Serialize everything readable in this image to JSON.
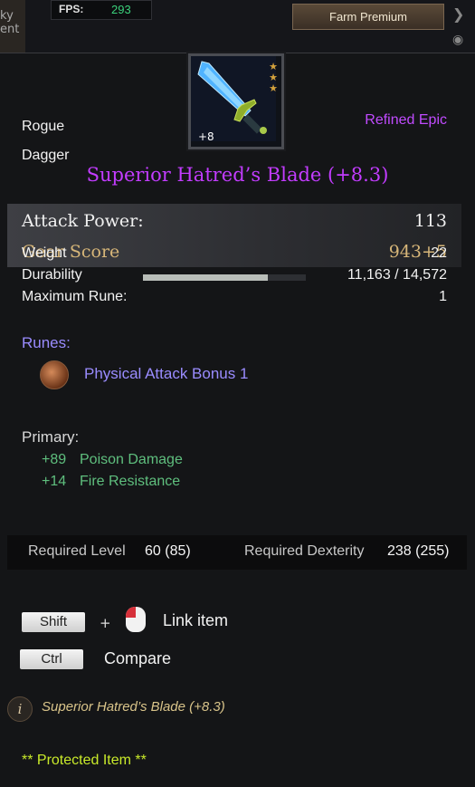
{
  "hud": {
    "tab_label": "ky ent",
    "fps_label": "FPS:",
    "fps_value": "293",
    "farm_button": "Farm Premium"
  },
  "item": {
    "enhance_level": "+8",
    "class": "Rogue",
    "type": "Dagger",
    "rarity": "Refined Epic",
    "name": "Superior Hatred’s Blade (+8.3)",
    "attack_power_label": "Attack Power:",
    "attack_power_value": "113",
    "gear_score_label": "Gear Score",
    "gear_score_value": "943+5",
    "weight_label": "Weight",
    "weight_value": "22",
    "durability_label": "Durability",
    "durability_value": "11,163 / 14,572",
    "durability_fraction": 0.766,
    "max_rune_label": "Maximum Rune:",
    "max_rune_value": "1",
    "runes_label": "Runes:",
    "rune_name": "Physical Attack Bonus 1",
    "primary_label": "Primary:",
    "primary": [
      {
        "value": "+89",
        "name": "Poison Damage"
      },
      {
        "value": "+14",
        "name": "Fire Resistance"
      }
    ],
    "req_level_label": "Required Level",
    "req_level_value": "60 (85)",
    "req_dex_label": "Required Dexterity",
    "req_dex_value": "238 (255)",
    "lore": "Superior Hatred’s Blade (+8.3)",
    "protected": "** Protected Item **"
  },
  "controls": {
    "shift_key": "Shift",
    "plus": "+",
    "link_label": "Link item",
    "ctrl_key": "Ctrl",
    "compare_label": "Compare"
  },
  "colors": {
    "rarity": "#c14bff",
    "stat_green": "#5fbf7e",
    "rune_purple": "#9a8cff",
    "gear_gold": "#d7b679",
    "protected": "#c9ea2a"
  },
  "icons": {
    "weapon": "dagger-icon",
    "rune": "rune-icon",
    "mouse": "mouse-left-click-icon",
    "info": "info-icon"
  }
}
